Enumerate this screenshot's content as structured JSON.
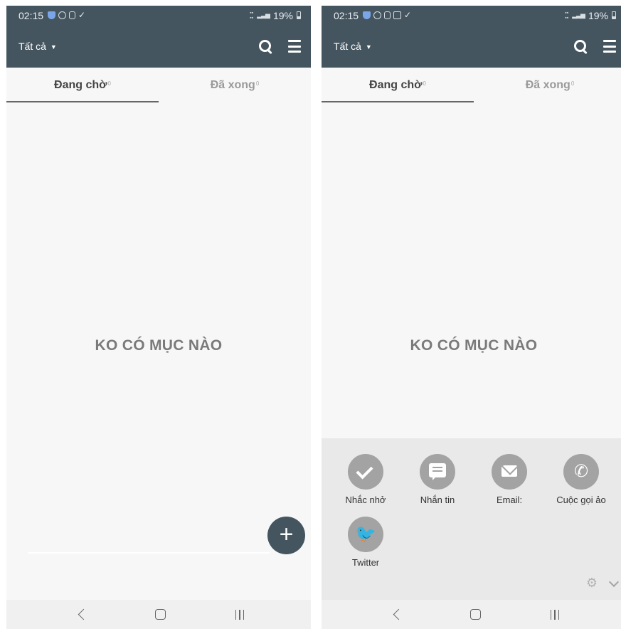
{
  "left": {
    "status_bar": {
      "time": "02:15",
      "battery": "19%"
    },
    "app_bar": {
      "filter_label": "Tất cả"
    },
    "tabs": [
      {
        "label": "Đang chờ",
        "count": "0"
      },
      {
        "label": "Đã xong",
        "count": "0"
      }
    ],
    "empty_message": "KO CÓ MỤC NÀO",
    "fab_label": "+"
  },
  "right": {
    "status_bar": {
      "time": "02:15",
      "battery": "19%"
    },
    "app_bar": {
      "filter_label": "Tất cả"
    },
    "tabs": [
      {
        "label": "Đang chờ",
        "count": "0"
      },
      {
        "label": "Đã xong",
        "count": "0"
      }
    ],
    "empty_message": "KO CÓ MỤC NÀO",
    "sheet": {
      "items": [
        {
          "label": "Nhắc nhở",
          "icon": "check-icon"
        },
        {
          "label": "Nhắn tin",
          "icon": "message-icon"
        },
        {
          "label": "Email:",
          "icon": "email-icon"
        },
        {
          "label": "Cuộc gọi ảo",
          "icon": "phone-call-icon"
        },
        {
          "label": "Twitter",
          "icon": "twitter-icon"
        }
      ]
    }
  },
  "colors": {
    "app_bar": "#455560",
    "fab": "#455560",
    "sheet_background": "#e9e9e9",
    "sheet_icon": "#a3a3a3",
    "screen_background": "#f7f7f7"
  }
}
